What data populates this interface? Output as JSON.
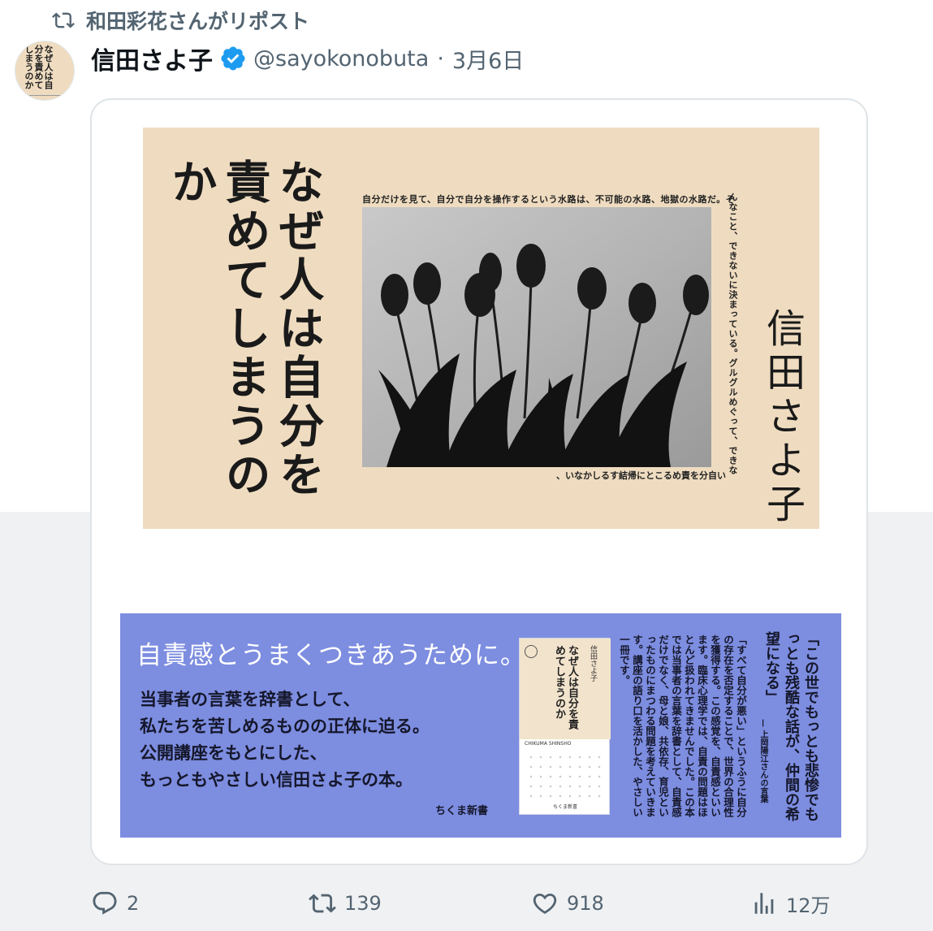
{
  "repost": {
    "text": "和田彩花さんがリポスト",
    "icon": "repost-icon"
  },
  "author": {
    "name": "信田さよ子",
    "verified": true,
    "verified_color": "#1d9bf0",
    "handle": "@sayokonobuta",
    "separator": "·",
    "date": "3月6日",
    "avatar_title": "なぜ人は自分を責めてしまうのか"
  },
  "cover": {
    "title": "なぜ人は自分を責めてしまうのか",
    "author": "信田さよ子",
    "quote_top": "自分だけを見て、自分で自分を操作するという水路は、不可能の水路、地獄の水路だ。そ",
    "quote_side": "んなこと、できないに決まっている。グルグルめぐって、できな",
    "quote_bottom": "、いなかしるす結帰にとこるめ責を分自い",
    "background": "#efdcc0"
  },
  "band": {
    "headline": "自責感とうまくつきあうために。",
    "body": [
      "当事者の言葉を辞書として、",
      "私たちを苦しめるものの正体に迫る。",
      "公開講座をもとにした、",
      "もっともやさしい信田さよ子の本。"
    ],
    "publisher": "ちくま新書",
    "book_title": "なぜ人は自分を責めてしまうのか",
    "book_author": "信田さよ子",
    "book_series": "CHIKUMA SHINSHO",
    "book_bottom": "ちくま新書",
    "description": "「すべて自分が悪い」というふうに自分の存在を否定することで、世界の合理性を獲得する。この感覚を、自責感といいます。臨床心理学では、自責の問題はほとんど扱われてきませんでした。この本では当事者の言葉を辞書として、自責感だけでなく、母と娘、共依存、育児といったものにまつわる問題を考えていきます。講座の語り口を活かした、やさしい一冊です。",
    "praise": "「この世でもっとも悲惨でもっとも残酷な話が、仲間の希望になる」",
    "credit": "— 上岡陽江さんの言葉",
    "background": "#7d8de0"
  },
  "actions": {
    "replies": "2",
    "reposts": "139",
    "likes": "918",
    "views": "12万"
  }
}
